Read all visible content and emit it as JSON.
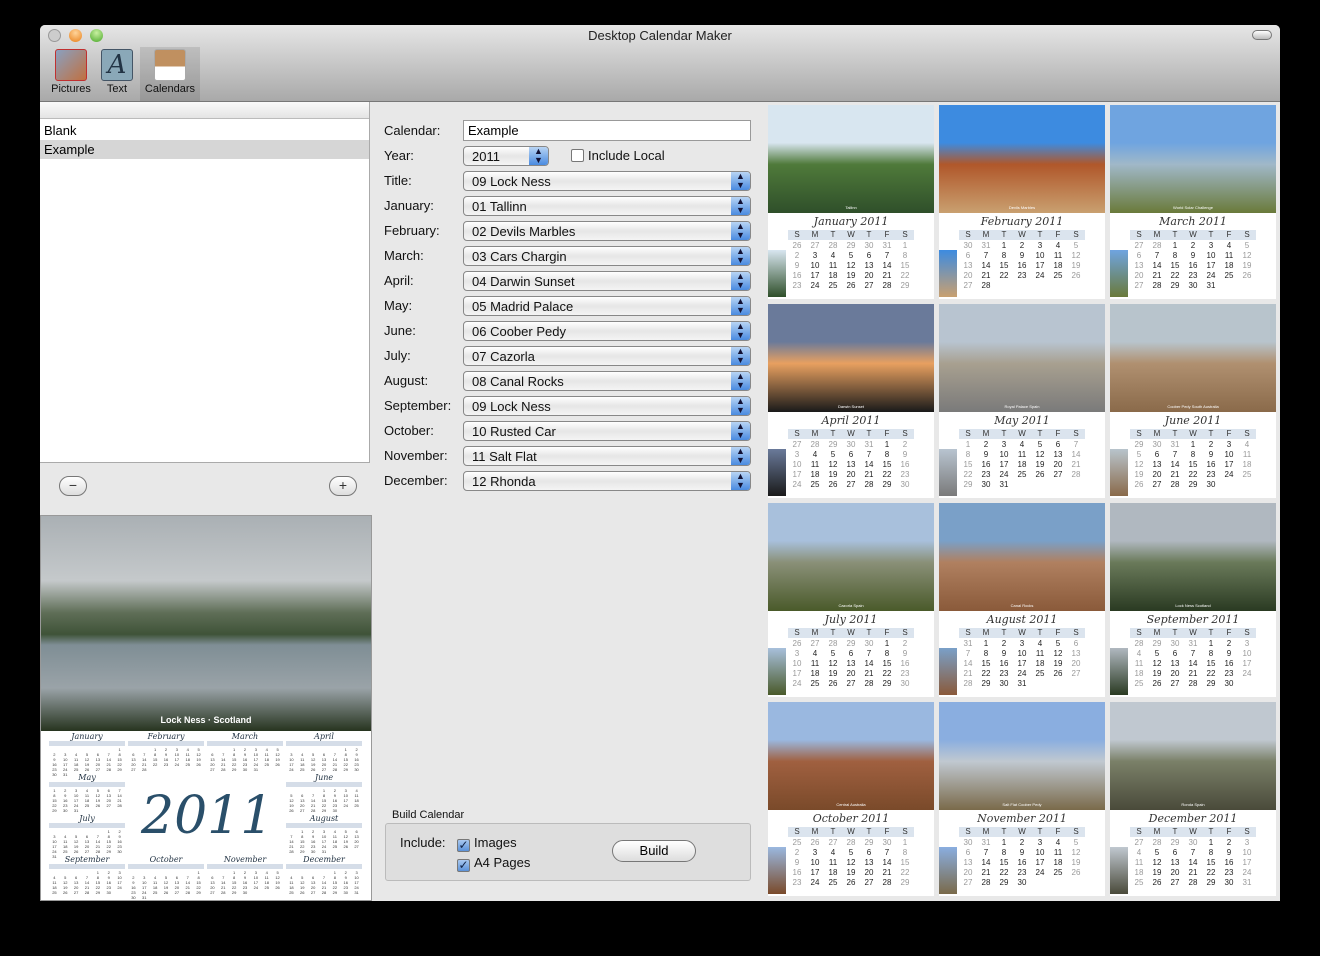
{
  "window": {
    "title": "Desktop Calendar Maker"
  },
  "toolbar": {
    "items": [
      {
        "label": "Pictures",
        "icon": "pictures-icon"
      },
      {
        "label": "Text",
        "icon": "text-icon"
      },
      {
        "label": "Calendars",
        "icon": "calendars-icon"
      }
    ]
  },
  "sidebar": {
    "items": [
      {
        "label": "Blank",
        "selected": false
      },
      {
        "label": "Example",
        "selected": true
      }
    ],
    "remove_label": "−",
    "add_label": "+"
  },
  "preview": {
    "caption": "Lock Ness · Scotland",
    "year": "2011",
    "months": [
      "January",
      "February",
      "March",
      "April",
      "May",
      "June",
      "July",
      "August",
      "September",
      "October",
      "November",
      "December"
    ]
  },
  "form": {
    "calendar_label": "Calendar:",
    "calendar_value": "Example",
    "year_label": "Year:",
    "year_value": "2011",
    "include_local_label": "Include Local",
    "include_local": false,
    "rows": [
      {
        "label": "Title:",
        "value": "09 Lock Ness"
      },
      {
        "label": "January:",
        "value": "01 Tallinn"
      },
      {
        "label": "February:",
        "value": "02 Devils Marbles"
      },
      {
        "label": "March:",
        "value": "03 Cars Chargin"
      },
      {
        "label": "April:",
        "value": "04 Darwin Sunset"
      },
      {
        "label": "May:",
        "value": "05 Madrid Palace"
      },
      {
        "label": "June:",
        "value": "06 Coober Pedy"
      },
      {
        "label": "July:",
        "value": "07 Cazorla"
      },
      {
        "label": "August:",
        "value": "08 Canal Rocks"
      },
      {
        "label": "September:",
        "value": "09 Lock Ness"
      },
      {
        "label": "October:",
        "value": "10 Rusted Car"
      },
      {
        "label": "November:",
        "value": "11 Salt Flat"
      },
      {
        "label": "December:",
        "value": "12 Rhonda"
      }
    ]
  },
  "build": {
    "group_label": "Build Calendar",
    "include_label": "Include:",
    "images_label": "Images",
    "images": true,
    "a4_label": "A4 Pages",
    "a4": true,
    "button_label": "Build"
  },
  "weekdays": [
    "S",
    "M",
    "T",
    "W",
    "T",
    "F",
    "S"
  ],
  "tiles": [
    {
      "title": "January 2011",
      "caption": "Tallinn",
      "colors": [
        "#d8e6f0",
        "#4f7a3a",
        "#2f4f2a"
      ]
    },
    {
      "title": "February 2011",
      "caption": "Devils Marbles",
      "colors": [
        "#3d8be0",
        "#b0572a",
        "#c9a070"
      ]
    },
    {
      "title": "March 2011",
      "caption": "World Solar Challenge",
      "colors": [
        "#6fa4e0",
        "#a0b8c8",
        "#6a7a3a"
      ]
    },
    {
      "title": "April 2011",
      "caption": "Darwin Sunset",
      "colors": [
        "#6a7a9a",
        "#e8a060",
        "#1a1a1a"
      ]
    },
    {
      "title": "May 2011",
      "caption": "Royal Palace Spain",
      "colors": [
        "#b8c4d0",
        "#a8a090",
        "#7a7a7a"
      ]
    },
    {
      "title": "June 2011",
      "caption": "Coober Pedy South Australia",
      "colors": [
        "#b8c4cc",
        "#b09070",
        "#8a6a4a"
      ]
    },
    {
      "title": "July 2011",
      "caption": "Cazorla Spain",
      "colors": [
        "#a8c0dc",
        "#8a9078",
        "#4a5a2a"
      ]
    },
    {
      "title": "August 2011",
      "caption": "Canal Rocks",
      "colors": [
        "#7aa0c8",
        "#b08060",
        "#8a5a3a"
      ]
    },
    {
      "title": "September 2011",
      "caption": "Lock Ness Scotland",
      "colors": [
        "#b0b8c0",
        "#6a7a5a",
        "#2a3a22"
      ]
    },
    {
      "title": "October 2011",
      "caption": "Central Australia",
      "colors": [
        "#9ab8e0",
        "#a06040",
        "#7a4a2a"
      ]
    },
    {
      "title": "November 2011",
      "caption": "Salt Flat Coober Pedy",
      "colors": [
        "#8aaee0",
        "#c0c8d0",
        "#7a6a4a"
      ]
    },
    {
      "title": "December 2011",
      "caption": "Ronda Spain",
      "colors": [
        "#c0c8d0",
        "#7a8068",
        "#4a4a3a"
      ]
    }
  ]
}
